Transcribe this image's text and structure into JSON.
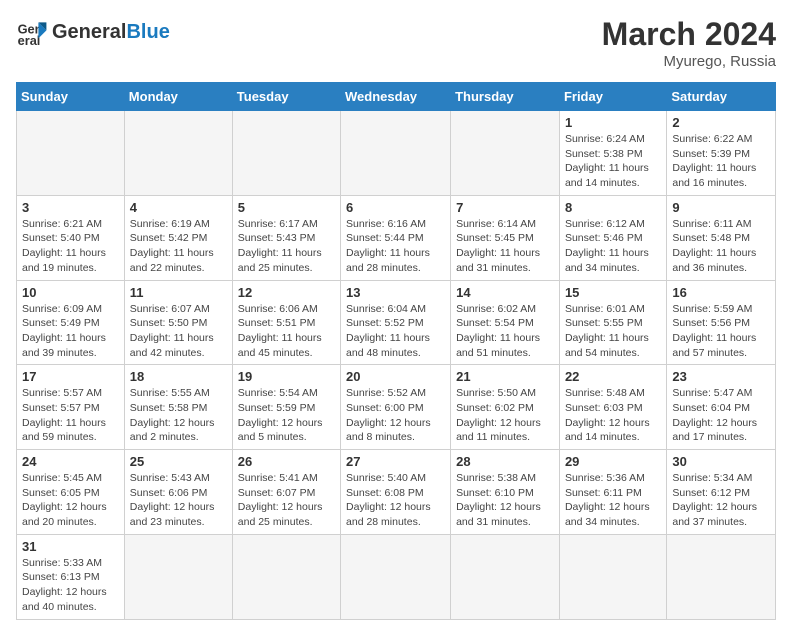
{
  "header": {
    "logo_general": "General",
    "logo_blue": "Blue",
    "month": "March 2024",
    "location": "Myurego, Russia"
  },
  "weekdays": [
    "Sunday",
    "Monday",
    "Tuesday",
    "Wednesday",
    "Thursday",
    "Friday",
    "Saturday"
  ],
  "weeks": [
    [
      {
        "day": "",
        "info": ""
      },
      {
        "day": "",
        "info": ""
      },
      {
        "day": "",
        "info": ""
      },
      {
        "day": "",
        "info": ""
      },
      {
        "day": "",
        "info": ""
      },
      {
        "day": "1",
        "info": "Sunrise: 6:24 AM\nSunset: 5:38 PM\nDaylight: 11 hours\nand 14 minutes."
      },
      {
        "day": "2",
        "info": "Sunrise: 6:22 AM\nSunset: 5:39 PM\nDaylight: 11 hours\nand 16 minutes."
      }
    ],
    [
      {
        "day": "3",
        "info": "Sunrise: 6:21 AM\nSunset: 5:40 PM\nDaylight: 11 hours\nand 19 minutes."
      },
      {
        "day": "4",
        "info": "Sunrise: 6:19 AM\nSunset: 5:42 PM\nDaylight: 11 hours\nand 22 minutes."
      },
      {
        "day": "5",
        "info": "Sunrise: 6:17 AM\nSunset: 5:43 PM\nDaylight: 11 hours\nand 25 minutes."
      },
      {
        "day": "6",
        "info": "Sunrise: 6:16 AM\nSunset: 5:44 PM\nDaylight: 11 hours\nand 28 minutes."
      },
      {
        "day": "7",
        "info": "Sunrise: 6:14 AM\nSunset: 5:45 PM\nDaylight: 11 hours\nand 31 minutes."
      },
      {
        "day": "8",
        "info": "Sunrise: 6:12 AM\nSunset: 5:46 PM\nDaylight: 11 hours\nand 34 minutes."
      },
      {
        "day": "9",
        "info": "Sunrise: 6:11 AM\nSunset: 5:48 PM\nDaylight: 11 hours\nand 36 minutes."
      }
    ],
    [
      {
        "day": "10",
        "info": "Sunrise: 6:09 AM\nSunset: 5:49 PM\nDaylight: 11 hours\nand 39 minutes."
      },
      {
        "day": "11",
        "info": "Sunrise: 6:07 AM\nSunset: 5:50 PM\nDaylight: 11 hours\nand 42 minutes."
      },
      {
        "day": "12",
        "info": "Sunrise: 6:06 AM\nSunset: 5:51 PM\nDaylight: 11 hours\nand 45 minutes."
      },
      {
        "day": "13",
        "info": "Sunrise: 6:04 AM\nSunset: 5:52 PM\nDaylight: 11 hours\nand 48 minutes."
      },
      {
        "day": "14",
        "info": "Sunrise: 6:02 AM\nSunset: 5:54 PM\nDaylight: 11 hours\nand 51 minutes."
      },
      {
        "day": "15",
        "info": "Sunrise: 6:01 AM\nSunset: 5:55 PM\nDaylight: 11 hours\nand 54 minutes."
      },
      {
        "day": "16",
        "info": "Sunrise: 5:59 AM\nSunset: 5:56 PM\nDaylight: 11 hours\nand 57 minutes."
      }
    ],
    [
      {
        "day": "17",
        "info": "Sunrise: 5:57 AM\nSunset: 5:57 PM\nDaylight: 11 hours\nand 59 minutes."
      },
      {
        "day": "18",
        "info": "Sunrise: 5:55 AM\nSunset: 5:58 PM\nDaylight: 12 hours\nand 2 minutes."
      },
      {
        "day": "19",
        "info": "Sunrise: 5:54 AM\nSunset: 5:59 PM\nDaylight: 12 hours\nand 5 minutes."
      },
      {
        "day": "20",
        "info": "Sunrise: 5:52 AM\nSunset: 6:00 PM\nDaylight: 12 hours\nand 8 minutes."
      },
      {
        "day": "21",
        "info": "Sunrise: 5:50 AM\nSunset: 6:02 PM\nDaylight: 12 hours\nand 11 minutes."
      },
      {
        "day": "22",
        "info": "Sunrise: 5:48 AM\nSunset: 6:03 PM\nDaylight: 12 hours\nand 14 minutes."
      },
      {
        "day": "23",
        "info": "Sunrise: 5:47 AM\nSunset: 6:04 PM\nDaylight: 12 hours\nand 17 minutes."
      }
    ],
    [
      {
        "day": "24",
        "info": "Sunrise: 5:45 AM\nSunset: 6:05 PM\nDaylight: 12 hours\nand 20 minutes."
      },
      {
        "day": "25",
        "info": "Sunrise: 5:43 AM\nSunset: 6:06 PM\nDaylight: 12 hours\nand 23 minutes."
      },
      {
        "day": "26",
        "info": "Sunrise: 5:41 AM\nSunset: 6:07 PM\nDaylight: 12 hours\nand 25 minutes."
      },
      {
        "day": "27",
        "info": "Sunrise: 5:40 AM\nSunset: 6:08 PM\nDaylight: 12 hours\nand 28 minutes."
      },
      {
        "day": "28",
        "info": "Sunrise: 5:38 AM\nSunset: 6:10 PM\nDaylight: 12 hours\nand 31 minutes."
      },
      {
        "day": "29",
        "info": "Sunrise: 5:36 AM\nSunset: 6:11 PM\nDaylight: 12 hours\nand 34 minutes."
      },
      {
        "day": "30",
        "info": "Sunrise: 5:34 AM\nSunset: 6:12 PM\nDaylight: 12 hours\nand 37 minutes."
      }
    ],
    [
      {
        "day": "31",
        "info": "Sunrise: 5:33 AM\nSunset: 6:13 PM\nDaylight: 12 hours\nand 40 minutes."
      },
      {
        "day": "",
        "info": ""
      },
      {
        "day": "",
        "info": ""
      },
      {
        "day": "",
        "info": ""
      },
      {
        "day": "",
        "info": ""
      },
      {
        "day": "",
        "info": ""
      },
      {
        "day": "",
        "info": ""
      }
    ]
  ]
}
